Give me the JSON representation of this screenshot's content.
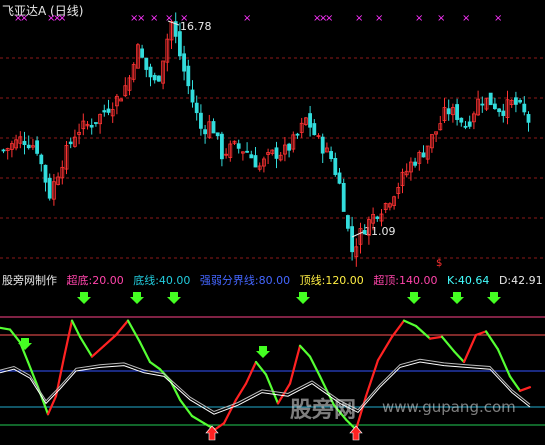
{
  "header": {
    "title": "飞亚达A (日线)"
  },
  "annotations": {
    "high_label": "16.78",
    "low_label": "11.09",
    "marker": "$"
  },
  "legend": {
    "name": "股旁网制作",
    "chaodi": "超底:20.00",
    "dixian": "底线:40.00",
    "qiangruo": "强弱分界线:80.00",
    "dingxian": "顶线:120.00",
    "chaoding": "超顶:140.00",
    "k": "K:40.64",
    "d": "D:42.91"
  },
  "watermark": {
    "text": "股旁网",
    "url": "www.gupang.com"
  },
  "colors": {
    "up": "#ff3333",
    "down": "#33dddd",
    "grid": "#8b1a1a",
    "line_top": "#ff4488",
    "line_ding": "#ff5555",
    "line_mid": "#3355ff",
    "line_di": "#22aacc",
    "line_chaodi": "#22cc55",
    "osc_up": "#ff2222",
    "osc_down": "#55ff33",
    "arrow": "#44ff22",
    "cross": "#ff33ff"
  },
  "chart_data": [
    {
      "type": "candlestick",
      "title": "飞亚达A (日线)",
      "high": 16.78,
      "low": 11.09
    },
    {
      "type": "line",
      "levels": [
        20,
        40,
        80,
        120,
        140
      ],
      "k_last": 40.64,
      "d_last": 42.91
    }
  ]
}
